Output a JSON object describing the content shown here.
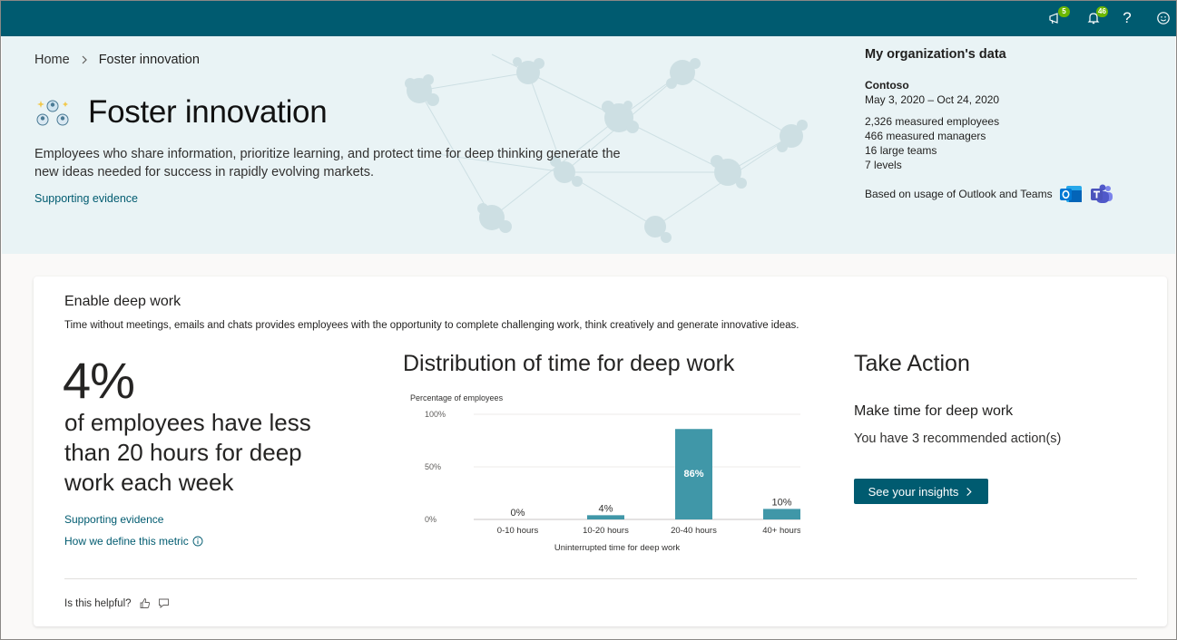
{
  "topbar": {
    "icons": [
      {
        "name": "feedback-icon",
        "badge": "5"
      },
      {
        "name": "bell-icon",
        "badge": "46"
      },
      {
        "name": "help-icon",
        "glyph": "?"
      },
      {
        "name": "smiley-icon"
      }
    ],
    "color": "#005b70"
  },
  "breadcrumb": {
    "home": "Home",
    "current": "Foster innovation"
  },
  "hero": {
    "title": "Foster innovation",
    "description": "Employees who share information, prioritize learning, and protect time for deep thinking generate the new ideas needed for success in rapidly evolving markets.",
    "supporting_link": "Supporting evidence"
  },
  "org": {
    "title": "My organization's data",
    "name": "Contoso",
    "range": "May 3, 2020 – Oct 24, 2020",
    "stats": [
      {
        "value": "2,326",
        "label": "measured employees"
      },
      {
        "value": "466",
        "label": "measured managers"
      },
      {
        "value": "16",
        "label": "large teams"
      },
      {
        "value": "7",
        "label": "levels"
      }
    ],
    "based_on": "Based on usage of Outlook and Teams"
  },
  "card": {
    "title": "Enable deep work",
    "description": "Time without meetings, emails and chats provides employees with the opportunity to complete challenging work, think creatively and generate innovative ideas.",
    "metric_value": "4%",
    "metric_text": "of employees have less than 20 hours for deep work each week",
    "link_supporting": "Supporting evidence",
    "link_define": "How we define this metric",
    "chart_title": "Distribution of time for deep work",
    "take_action": {
      "title": "Take Action",
      "subtitle": "Make time for deep work",
      "recommendations": "You have 3 recommended action(s)",
      "button": "See your insights"
    },
    "helpful": "Is this helpful?"
  },
  "chart_data": {
    "type": "bar",
    "title": "Distribution of time for deep work",
    "ylabel": "Percentage of employees",
    "xlabel": "Uninterrupted time for deep work",
    "categories": [
      "0-10 hours",
      "10-20 hours",
      "20-40 hours",
      "40+ hours"
    ],
    "values": [
      0,
      4,
      86,
      10
    ],
    "value_labels": [
      "0%",
      "4%",
      "86%",
      "10%"
    ],
    "yticks": [
      "0%",
      "50%",
      "100%"
    ],
    "ylim": [
      0,
      100
    ],
    "color": "#4097a8",
    "grid": true
  }
}
